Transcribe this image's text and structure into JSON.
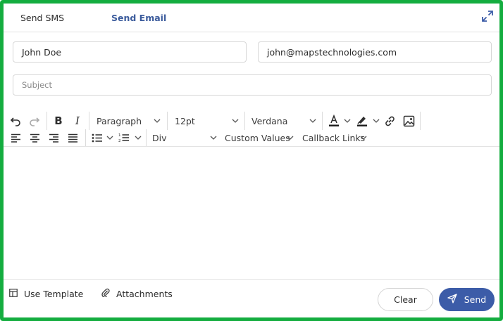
{
  "tabs": {
    "sms": "Send SMS",
    "email": "Send Email",
    "active": "email"
  },
  "form": {
    "name_value": "John Doe",
    "email_value": "john@mapstechnologies.com",
    "subject_placeholder": "Subject"
  },
  "toolbar": {
    "block_format": "Paragraph",
    "font_size": "12pt",
    "font_family": "Verdana",
    "container": "Div",
    "custom_values": "Custom Values",
    "callback_links": "Callback Links",
    "icons": [
      "undo-icon",
      "redo-icon",
      "bold-icon",
      "italic-icon",
      "text-color-icon",
      "highlight-icon",
      "link-icon",
      "image-icon",
      "align-left-icon",
      "align-center-icon",
      "align-right-icon",
      "align-justify-icon",
      "bullet-list-icon",
      "numbered-list-icon"
    ]
  },
  "footer": {
    "use_template": "Use Template",
    "attachments": "Attachments",
    "clear": "Clear",
    "send": "Send"
  },
  "colors": {
    "accent": "#3c5ca8",
    "frame": "#14ad3f",
    "active_tab": "#3b5b9c"
  }
}
